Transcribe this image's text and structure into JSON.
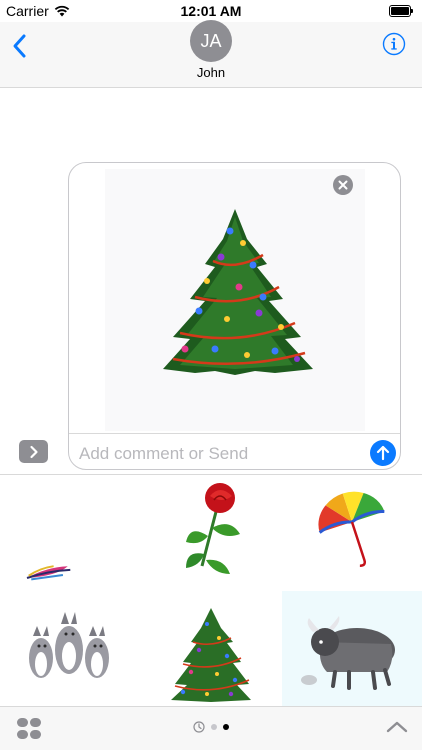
{
  "status_bar": {
    "carrier": "Carrier",
    "time": "12:01 AM"
  },
  "header": {
    "avatar_initials": "JA",
    "contact_name": "John"
  },
  "compose": {
    "placeholder": "Add comment or Send"
  },
  "drawer": {
    "stickers": [
      {
        "name": "feather"
      },
      {
        "name": "rose"
      },
      {
        "name": "rainbow-umbrella"
      },
      {
        "name": "husky-dogs"
      },
      {
        "name": "christmas-tree"
      },
      {
        "name": "yak",
        "selected": true
      }
    ]
  },
  "bottom_bar": {
    "pages": 2,
    "active_page": 2
  },
  "colors": {
    "accent": "#0a7aff",
    "header_bg": "#f7f7f7",
    "selected_cell_bg": "#eefafd"
  }
}
